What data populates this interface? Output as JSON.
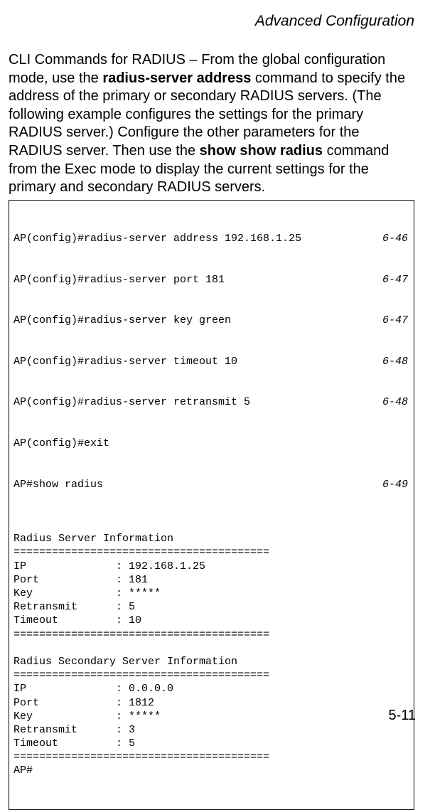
{
  "header": "Advanced Configuration",
  "para": {
    "p1": "CLI Commands for RADIUS – From the global configuration mode, use the ",
    "b1": "radius-server address",
    "p2": " command to specify the address of the primary or secondary RADIUS servers. (The following example configures the settings for the primary RADIUS server.) Configure the other parameters for the RADIUS server. Then use the ",
    "b2": "show show radius",
    "p3": " command from the Exec mode to display the current settings for the primary and secondary RADIUS servers."
  },
  "cli": {
    "rows": [
      {
        "cmd": "AP(config)#radius-server address 192.168.1.25",
        "ref": "6-46"
      },
      {
        "cmd": "AP(config)#radius-server port 181",
        "ref": "6-47"
      },
      {
        "cmd": "AP(config)#radius-server key green",
        "ref": "6-47"
      },
      {
        "cmd": "AP(config)#radius-server timeout 10",
        "ref": "6-48"
      },
      {
        "cmd": "AP(config)#radius-server retransmit 5",
        "ref": "6-48"
      }
    ],
    "plain": "AP(config)#exit\nAP#show radius",
    "showref": "6-49",
    "body": "\nRadius Server Information\n========================================\nIP              : 192.168.1.25\nPort            : 181\nKey             : *****\nRetransmit      : 5\nTimeout         : 10\n========================================\n\nRadius Secondary Server Information\n========================================\nIP              : 0.0.0.0\nPort            : 1812\nKey             : *****\nRetransmit      : 3\nTimeout         : 5\n========================================\nAP#"
  },
  "footer": "5-11"
}
